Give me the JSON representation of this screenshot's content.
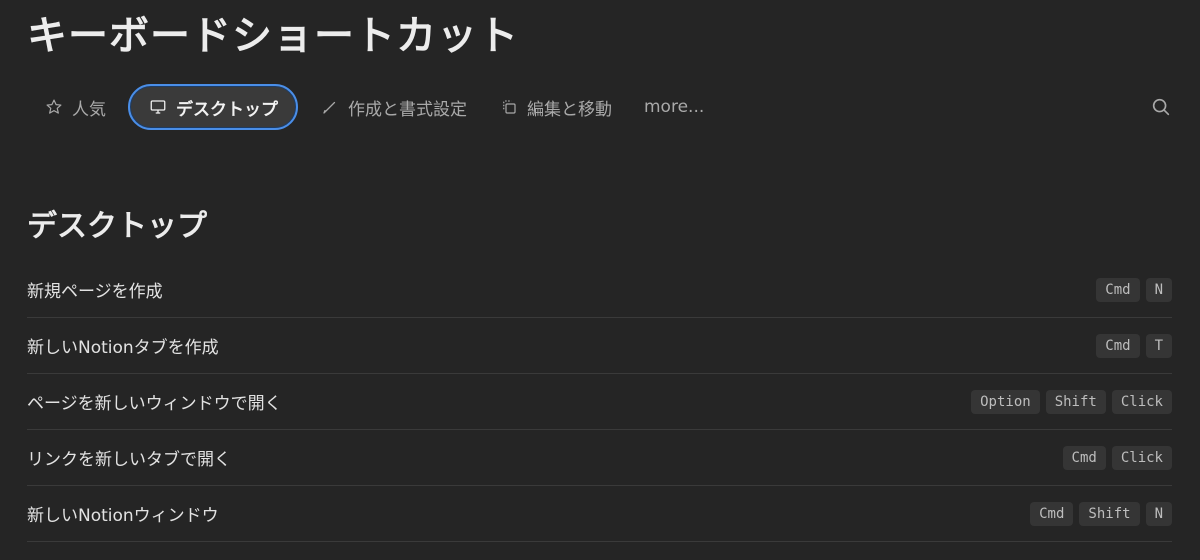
{
  "page": {
    "title": "キーボードショートカット"
  },
  "tabs": [
    {
      "label": "人気",
      "icon": "star-icon",
      "active": false
    },
    {
      "label": "デスクトップ",
      "icon": "monitor-icon",
      "active": true
    },
    {
      "label": "作成と書式設定",
      "icon": "pencil-icon",
      "active": false
    },
    {
      "label": "編集と移動",
      "icon": "copy-icon",
      "active": false
    },
    {
      "label": "more...",
      "icon": "",
      "active": false
    }
  ],
  "search": {
    "icon": "search-icon"
  },
  "section": {
    "title": "デスクトップ"
  },
  "shortcuts": [
    {
      "label": "新規ページを作成",
      "keys": [
        "Cmd",
        "N"
      ]
    },
    {
      "label": "新しいNotionタブを作成",
      "keys": [
        "Cmd",
        "T"
      ]
    },
    {
      "label": "ページを新しいウィンドウで開く",
      "keys": [
        "Option",
        "Shift",
        "Click"
      ]
    },
    {
      "label": "リンクを新しいタブで開く",
      "keys": [
        "Cmd",
        "Click"
      ]
    },
    {
      "label": "新しいNotionウィンドウ",
      "keys": [
        "Cmd",
        "Shift",
        "N"
      ]
    }
  ],
  "colors": {
    "background": "#252525",
    "active_tab_border": "#4a8ee8",
    "key_background": "#353535"
  }
}
